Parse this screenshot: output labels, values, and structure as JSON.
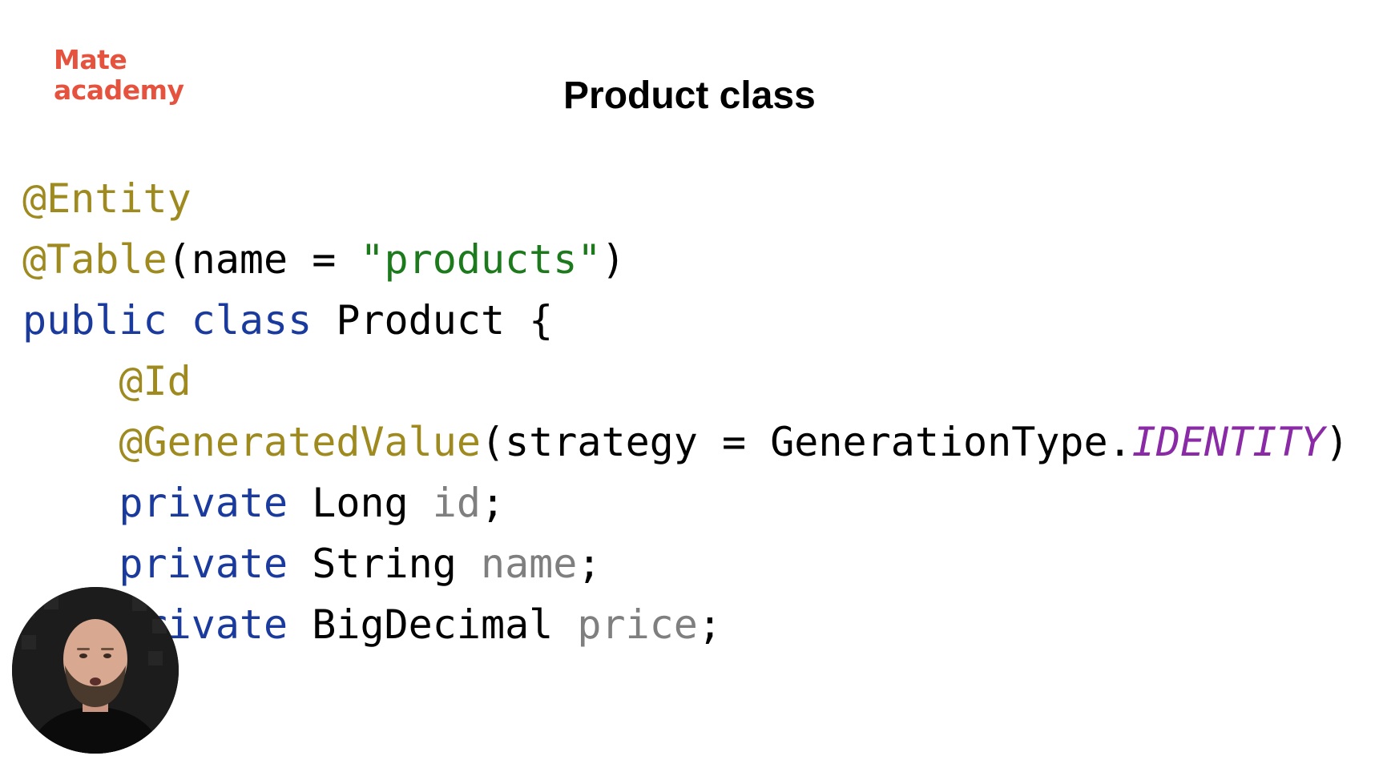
{
  "logo": {
    "line1": "Mate",
    "line2": "academy"
  },
  "slide": {
    "title": "Product class"
  },
  "code": {
    "lines": [
      [
        {
          "t": "@Entity",
          "c": "ann"
        }
      ],
      [
        {
          "t": "@Table",
          "c": "ann"
        },
        {
          "t": "(name = ",
          "c": "plain"
        },
        {
          "t": "\"products\"",
          "c": "str"
        },
        {
          "t": ")",
          "c": "plain"
        }
      ],
      [
        {
          "t": "public class",
          "c": "kw"
        },
        {
          "t": " Product {",
          "c": "plain"
        }
      ],
      [
        {
          "t": "    ",
          "c": "plain"
        },
        {
          "t": "@Id",
          "c": "ann"
        }
      ],
      [
        {
          "t": "    ",
          "c": "plain"
        },
        {
          "t": "@GeneratedValue",
          "c": "ann"
        },
        {
          "t": "(strategy = GenerationType.",
          "c": "plain"
        },
        {
          "t": "IDENTITY",
          "c": "cst"
        },
        {
          "t": ")",
          "c": "plain"
        }
      ],
      [
        {
          "t": "    ",
          "c": "plain"
        },
        {
          "t": "private",
          "c": "kw"
        },
        {
          "t": " Long ",
          "c": "plain"
        },
        {
          "t": "id",
          "c": "fld"
        },
        {
          "t": ";",
          "c": "plain"
        }
      ],
      [
        {
          "t": "    ",
          "c": "plain"
        },
        {
          "t": "private",
          "c": "kw"
        },
        {
          "t": " String ",
          "c": "plain"
        },
        {
          "t": "name",
          "c": "fld"
        },
        {
          "t": ";",
          "c": "plain"
        }
      ],
      [
        {
          "t": "    ",
          "c": "plain"
        },
        {
          "t": "private",
          "c": "kw"
        },
        {
          "t": " BigDecimal ",
          "c": "plain"
        },
        {
          "t": "price",
          "c": "fld"
        },
        {
          "t": ";",
          "c": "plain"
        }
      ]
    ]
  },
  "colors": {
    "brand": "#e5533f",
    "annotation": "#9e8a1e",
    "string": "#1c7a1c",
    "keyword": "#1a3a9e",
    "field": "#7f7f7f",
    "constant": "#8a2aa6"
  },
  "presenter": {
    "icon": "presenter-video-icon"
  }
}
